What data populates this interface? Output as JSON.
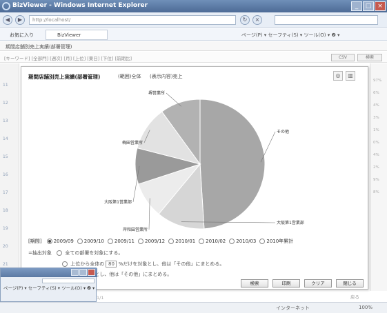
{
  "window": {
    "title": "BizViewer - Windows Internet Explorer",
    "min": "_",
    "max": "□",
    "close": "×"
  },
  "nav": {
    "back": "◀",
    "forward": "▶",
    "address": "http://localhost/",
    "search_placeholder": "",
    "refresh": "↻",
    "stop": "×"
  },
  "favorites": {
    "label": "お気に入り",
    "tab": "BizViewer",
    "commands": "ページ(P) ▾  セーフティ(S) ▾  ツール(O) ▾  ❷ ▾"
  },
  "app": {
    "header": "期間店舗別売上実績(部署管理)",
    "filters": "[キーワード]  [全部門]  [週次]  [月]  [上位]  [東日]  [下位]  [前期比]",
    "csv": "CSV",
    "search": "検索"
  },
  "background": {
    "row_numbers": [
      "11",
      "12",
      "13",
      "14",
      "15",
      "16",
      "17",
      "18",
      "19",
      "20",
      "21",
      "22"
    ],
    "right_values": [
      "97%",
      "6%",
      "4%",
      "3%",
      "1%",
      "0%",
      "4%",
      "2%",
      "9%",
      "8%"
    ]
  },
  "dialog": {
    "title": "期間店舗別売上実績(部署管理)",
    "range": "(範囲)全体",
    "display": "(表示内容)売上",
    "icon_chart": "◎",
    "icon_bar": "▥",
    "period_label": "[期間]",
    "periods": [
      "2009/09",
      "2009/10",
      "2009/11",
      "2009/12",
      "2010/01",
      "2010/02",
      "2010/03",
      "2010年累計"
    ],
    "selected_period": 0,
    "option_all_prefix": "=抽出対象",
    "option_all": "全ての部署を対象にする。",
    "option_top_prefix": "上位から全体の",
    "option_top_value": "80",
    "option_top_suffix": "%だけを対象とし、他は「その他」にまとめる。",
    "option_rank_suffix": "だけを対象とし、他は「その他」にまとめる。",
    "buttons": {
      "search": "検索",
      "print": "印刷",
      "clear": "クリア",
      "close": "閉じる"
    }
  },
  "chart_data": {
    "type": "pie",
    "title": "",
    "slices": [
      {
        "label": "その他",
        "value": 49
      },
      {
        "label": "大阪第1営業部",
        "value": 12
      },
      {
        "label": "岸和田営業所",
        "value": 9
      },
      {
        "label": "大阪第1営業部",
        "value": 9
      },
      {
        "label": "梅田営業所",
        "value": 11
      },
      {
        "label": "堺営業所",
        "value": 10
      }
    ],
    "colors": [
      "#a7a7a7",
      "#d6d6d6",
      "#ececec",
      "#9a9a9a",
      "#e2e2e2",
      "#b2b2b2"
    ]
  },
  "statusbar": {
    "zone": "インターネット",
    "zoom": "100%"
  },
  "window2": {
    "commands": "ページ(P) ▾  セーフティ(S) ▾  ツール(O) ▾  ❷ ▾"
  },
  "page": {
    "number": "1/1",
    "return": "戻る"
  }
}
